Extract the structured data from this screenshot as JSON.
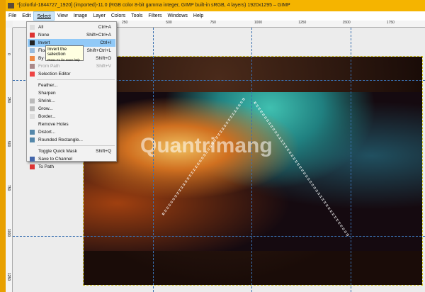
{
  "window": {
    "title": "*[colorful-1844727_1920] (imported)-11.0 (RGB color 8-bit gamma integer, GIMP built-in sRGB, 4 layers) 1920x1295 – GIMP"
  },
  "menubar": [
    "File",
    "Edit",
    "Select",
    "View",
    "Image",
    "Layer",
    "Colors",
    "Tools",
    "Filters",
    "Windows",
    "Help"
  ],
  "hruler": [
    "250",
    "500",
    "750",
    "1000",
    "1250",
    "1500",
    "1750"
  ],
  "vruler": [
    "0",
    "250",
    "500",
    "750",
    "1000",
    "1250"
  ],
  "select_menu": [
    {
      "label": "All",
      "shortcut": "Ctrl+A",
      "icon": "select-all-icon"
    },
    {
      "label": "None",
      "shortcut": "Shift+Ctrl+A",
      "icon": "select-none-icon"
    },
    {
      "label": "Invert",
      "shortcut": "Ctrl+I",
      "icon": "invert-icon",
      "highlight": true
    },
    {
      "label": "Float",
      "shortcut": "Shift+Ctrl+L",
      "icon": "float-icon"
    },
    {
      "label": "By Color",
      "shortcut": "Shift+O",
      "icon": "by-color-icon"
    },
    {
      "label": "From Path",
      "shortcut": "Shift+V",
      "icon": "from-path-icon",
      "disabled": true
    },
    {
      "label": "Selection Editor",
      "shortcut": "",
      "icon": "selection-editor-icon"
    },
    {
      "label": "Feather...",
      "shortcut": ""
    },
    {
      "label": "Sharpen",
      "shortcut": ""
    },
    {
      "label": "Shrink...",
      "shortcut": "",
      "icon": "shrink-icon"
    },
    {
      "label": "Grow...",
      "shortcut": "",
      "icon": "grow-icon"
    },
    {
      "label": "Border...",
      "shortcut": "",
      "icon": "border-icon"
    },
    {
      "label": "Remove Holes",
      "shortcut": ""
    },
    {
      "label": "Distort...",
      "shortcut": "",
      "icon": "distort-icon"
    },
    {
      "label": "Rounded Rectangle...",
      "shortcut": "",
      "icon": "rounded-rect-icon"
    },
    {
      "label": "Toggle Quick Mask",
      "shortcut": "Shift+Q"
    },
    {
      "label": "Save to Channel",
      "shortcut": "",
      "icon": "save-channel-icon"
    },
    {
      "label": "To Path",
      "shortcut": "",
      "icon": "to-path-icon"
    }
  ],
  "tooltip": {
    "title": "Invert the selection",
    "hint": "Press F1 for more help"
  },
  "watermark": "Quantrimang",
  "colors": {
    "highlight": "#91c9f7",
    "titlebar": "#f5b400"
  }
}
